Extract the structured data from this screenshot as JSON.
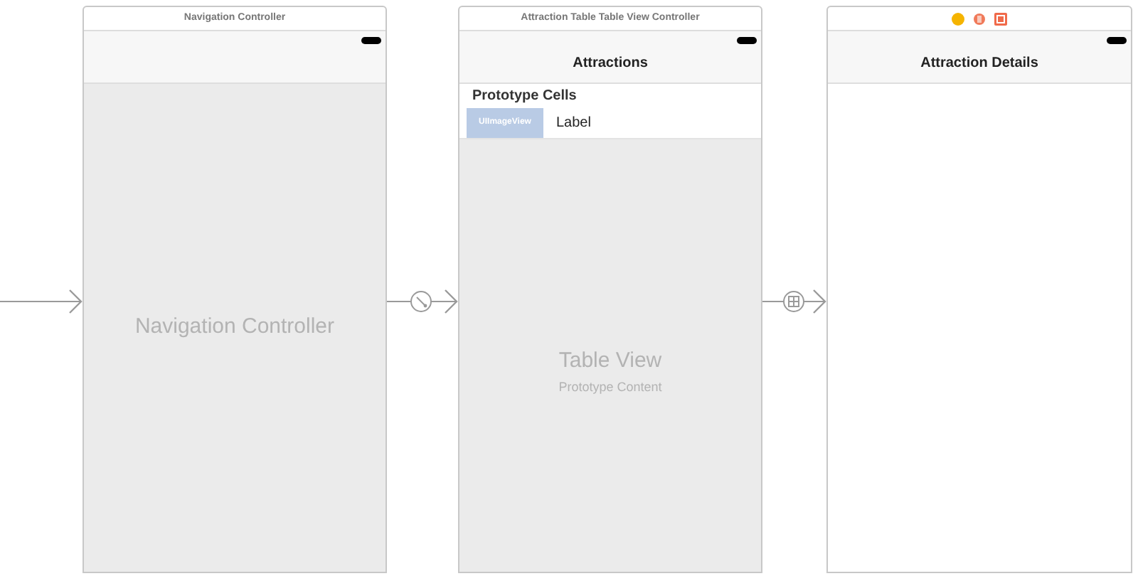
{
  "scenes": [
    {
      "kind": "navigation",
      "title": "Navigation Controller",
      "placeholder_text": "Navigation Controller"
    },
    {
      "kind": "table",
      "title": "Attraction Table Table View Controller",
      "nav_title": "Attractions",
      "section_header": "Prototype Cells",
      "cell": {
        "image_label": "UIImageView",
        "label": "Label"
      },
      "table_title": "Table View",
      "table_subtitle": "Prototype Content"
    },
    {
      "kind": "detail",
      "nav_title": "Attraction Details"
    }
  ],
  "segues": [
    {
      "kind": "entry"
    },
    {
      "kind": "relationship"
    },
    {
      "kind": "show"
    }
  ]
}
